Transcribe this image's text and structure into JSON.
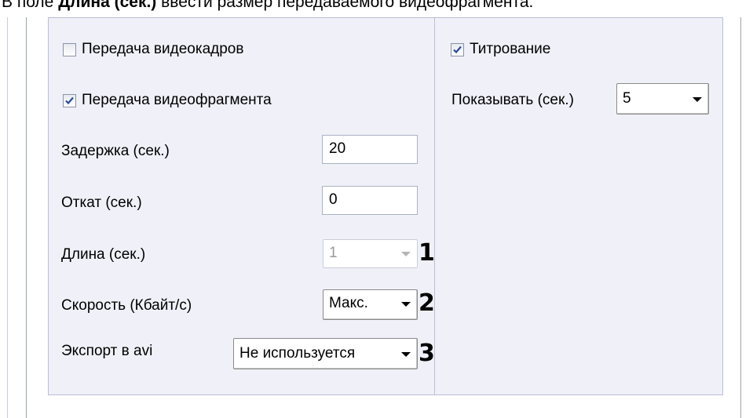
{
  "caption": {
    "prefix": "В поле ",
    "bold": "Длина (сек.)",
    "suffix": " ввести размер передаваемого видеофрагмента."
  },
  "left_panel": {
    "frame_transfer": {
      "label": "Передача видеокадров",
      "checked": false
    },
    "clip_transfer": {
      "label": "Передача видеофрагмента",
      "checked": true
    },
    "delay": {
      "label": "Задержка (сек.)",
      "value": "20"
    },
    "rollback": {
      "label": "Откат (сек.)",
      "value": "0"
    },
    "length": {
      "label": "Длина (сек.)",
      "value": "1",
      "enabled": false,
      "marker": "1"
    },
    "speed": {
      "label": "Скорость (Кбайт/с)",
      "value": "Макс.",
      "marker": "2"
    },
    "avi_export": {
      "label": "Экспорт в avi",
      "value": "Не используется",
      "marker": "3"
    }
  },
  "right_panel": {
    "captioning": {
      "label": "Титрование",
      "checked": true
    },
    "show": {
      "label": "Показывать (сек.)",
      "value": "5"
    }
  },
  "colors": {
    "panel_bg": "#f0f0f8",
    "check_mark": "#2a4a9c",
    "disabled_text": "#9a9a9a"
  }
}
